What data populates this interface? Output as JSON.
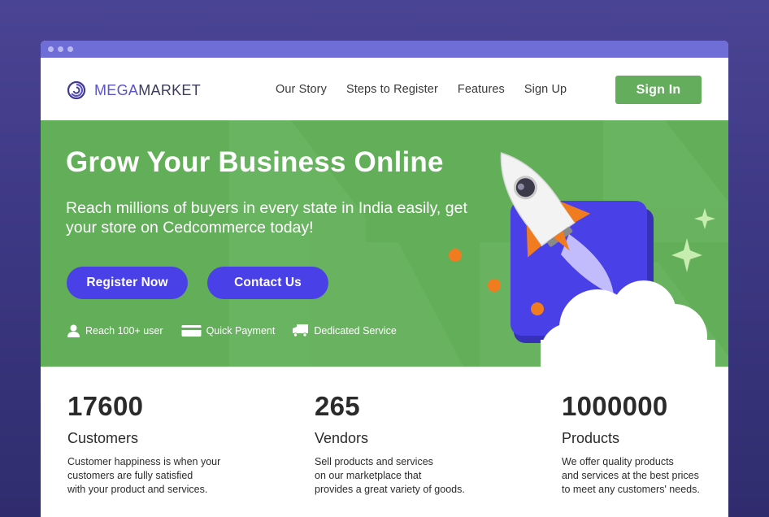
{
  "brand": {
    "name_part1": "MEGA",
    "name_part2": "MARKET",
    "color": "#5b54c9"
  },
  "nav": {
    "items": [
      {
        "label": "Our Story"
      },
      {
        "label": "Steps to Register"
      },
      {
        "label": "Features"
      },
      {
        "label": "Sign Up"
      }
    ],
    "signin_label": "Sign In"
  },
  "hero": {
    "title": "Grow Your Business Online",
    "subtitle": "Reach millions of buyers in every state in India easily, get your store on Cedcommerce today!",
    "register_label": "Register Now",
    "contact_label": "Contact Us",
    "features": [
      {
        "icon": "user-icon",
        "label": "Reach 100+ user"
      },
      {
        "icon": "credit-card-icon",
        "label": "Quick Payment"
      },
      {
        "icon": "truck-icon",
        "label": "Dedicated Service"
      }
    ]
  },
  "stats": [
    {
      "value": "17600",
      "label": "Customers",
      "description": "Customer happiness is when your\ncustomers are fully satisfied\nwith your product and services."
    },
    {
      "value": "265",
      "label": "Vendors",
      "description": "Sell products and services\non our marketplace that\nprovides a great variety of goods."
    },
    {
      "value": "1000000",
      "label": "Products",
      "description": "We offer quality products\nand services at the best prices\nto meet any customers' needs."
    }
  ],
  "colors": {
    "accent_green": "#63ad5c",
    "hero_green": "#62ae59",
    "button_blue": "#4a40e8",
    "titlebar": "#6f6ed6",
    "background": "#3d3883"
  }
}
